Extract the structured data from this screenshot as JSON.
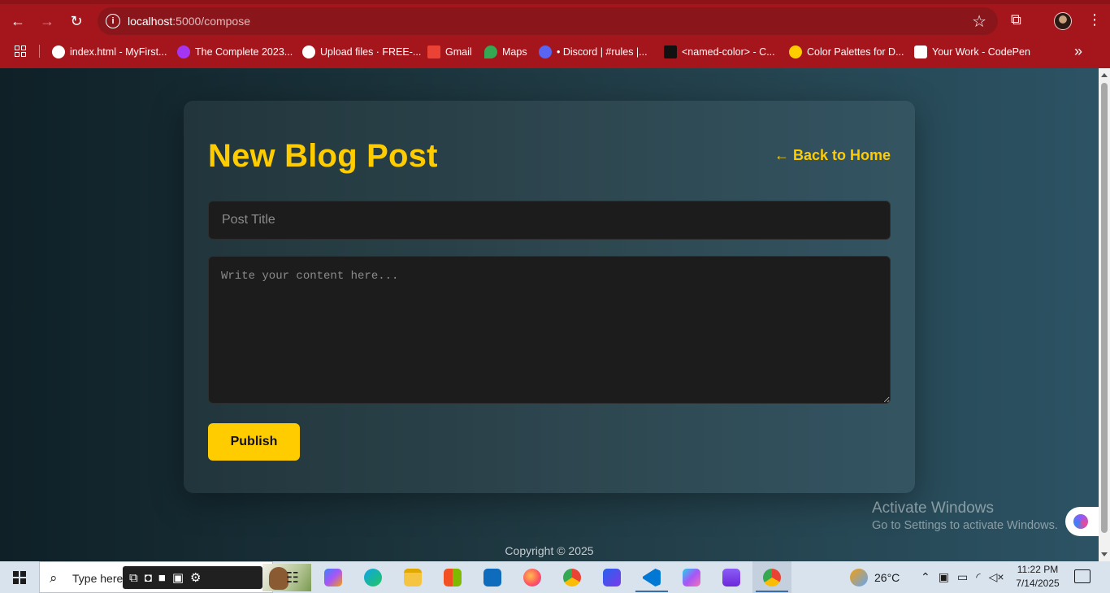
{
  "browser": {
    "url_host": "localhost",
    "url_path": ":5000/compose",
    "bookmarks": [
      {
        "label": "index.html - MyFirst...",
        "color": "#ffffff"
      },
      {
        "label": "The Complete 2023...",
        "color": "#a435f0"
      },
      {
        "label": "Upload files · FREE-...",
        "color": "#ffffff"
      },
      {
        "label": "Gmail",
        "color": "#ea4335"
      },
      {
        "label": "Maps",
        "color": "#34a853"
      },
      {
        "label": "• Discord | #rules |...",
        "color": "#5865f2"
      },
      {
        "label": "<named-color> - C...",
        "color": "#111111"
      },
      {
        "label": "Color Palettes for D...",
        "color": "#ffcc00"
      },
      {
        "label": "Your Work - CodePen",
        "color": "#ffffff"
      }
    ]
  },
  "page": {
    "heading": "New Blog Post",
    "back_link": "← Back to Home",
    "title_placeholder": "Post Title",
    "content_placeholder": "Write your content here...",
    "publish_label": "Publish",
    "footer": "Copyright © 2025",
    "accent_color": "#ffcc00"
  },
  "watermark": {
    "line1": "Activate Windows",
    "line2": "Go to Settings to activate Windows."
  },
  "taskbar": {
    "search_placeholder": "Type here",
    "weather": "26°C",
    "time": "11:22 PM",
    "date": "7/14/2025"
  }
}
